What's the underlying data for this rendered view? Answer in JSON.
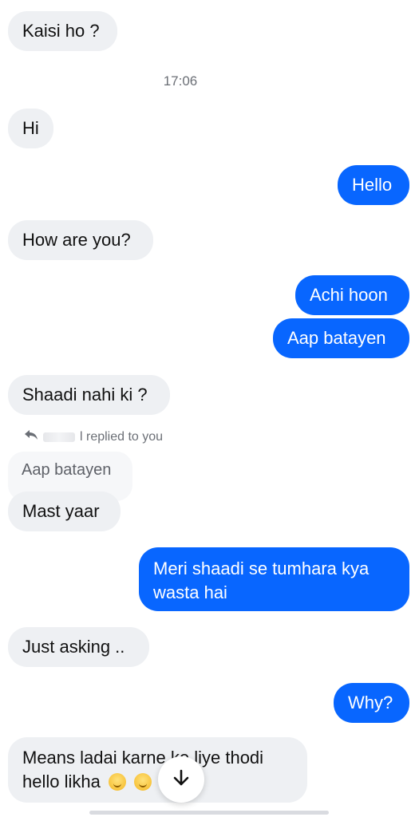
{
  "timestamp": "17:06",
  "messages": [
    {
      "side": "in",
      "text": "Kaisi ho ?"
    },
    {
      "side": "in",
      "text": "Hi"
    },
    {
      "side": "out",
      "text": "Hello"
    },
    {
      "side": "in",
      "text": "How are you?"
    },
    {
      "side": "out",
      "text": "Achi hoon"
    },
    {
      "side": "out",
      "text": "Aap batayen"
    },
    {
      "side": "in",
      "text": "Shaadi nahi ki ?"
    },
    {
      "side": "in",
      "text": "Mast yaar"
    },
    {
      "side": "out",
      "text": "Meri shaadi se tumhara kya wasta hai"
    },
    {
      "side": "in",
      "text": "Just asking .."
    },
    {
      "side": "out",
      "text": "Why?"
    },
    {
      "side": "in",
      "text": "Means ladai karne ke liye thodi hello likha"
    }
  ],
  "reply": {
    "note": "l replied to you",
    "quoted_text": "Aap batayen"
  },
  "colors": {
    "outgoing": "#0866ff",
    "incoming": "#eef0f3"
  },
  "icons": {
    "reply": "reply-arrow-icon",
    "scroll_down": "arrow-down-icon",
    "emoji": "smiling-face-icon"
  }
}
